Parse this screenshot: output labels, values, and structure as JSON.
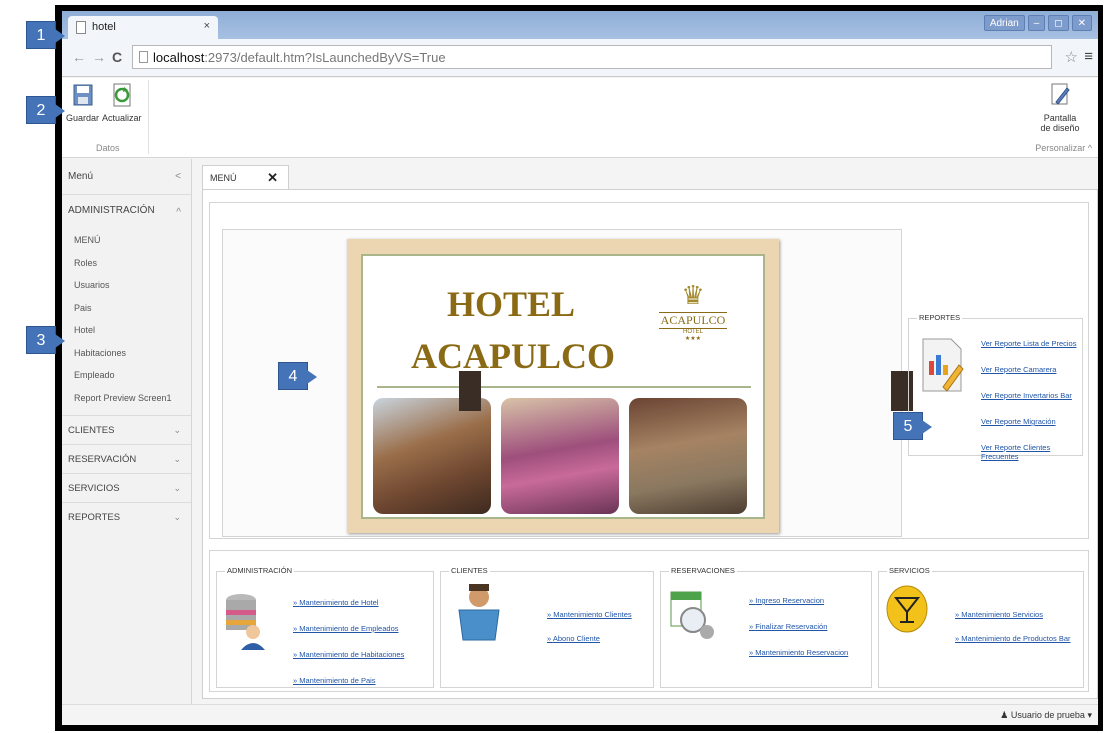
{
  "browser": {
    "tab_title": "hotel",
    "tab_close": "×",
    "window_controls": [
      "Adrian",
      "–",
      "◻",
      "✕"
    ],
    "url_host": "localhost",
    "url_rest": ":2973/default.htm?IsLaunchedByVS=True"
  },
  "ribbon": {
    "save_label": "Guardar",
    "refresh_label": "Actualizar",
    "group_data": "Datos",
    "design_label_1": "Pantalla",
    "design_label_2": "de diseño",
    "group_customize": "Personalizar"
  },
  "sidebar": {
    "title": "Menú",
    "admin_header": "ADMINISTRACIÓN",
    "admin_items": [
      "MENÚ",
      "Roles",
      "Usuarios",
      "Pais",
      "Hotel",
      "Habitaciones",
      "Empleado",
      "Report Preview Screen1"
    ],
    "sections": [
      "CLIENTES",
      "RESERVACIÓN",
      "SERVICIOS",
      "REPORTES"
    ]
  },
  "content": {
    "tab_label": "MENÚ",
    "tab_close": "✕",
    "poster_line1": "HOTEL",
    "poster_line2": "ACAPULCO",
    "logo_name": "ACAPULCO",
    "logo_sub": "HOTEL",
    "logo_stars": "★★★"
  },
  "reportes": {
    "legend": "REPORTES",
    "links": [
      "Ver Reporte Lista de Precios",
      "Ver Reporte Camarera",
      "Ver Reporte Invertarios Bar",
      "Ver Reporte Migración",
      "Ver Reporte Clientes Frecuentes"
    ]
  },
  "sections": {
    "admin": {
      "legend": "ADMINISTRACIÓN",
      "links": [
        "Mantenimiento de Hotel",
        "Mantenimiento de Empleados",
        "Mantenimiento de Habitaciones",
        "Mantenimiento de Pais"
      ]
    },
    "clientes": {
      "legend": "CLIENTES",
      "links": [
        "Mantenimiento Clientes",
        "Abono Cliente"
      ]
    },
    "reservaciones": {
      "legend": "RESERVACIONES",
      "links": [
        "Ingreso Reservacion",
        "Finalizar Reservación",
        "Mantenimiento Reservacion"
      ]
    },
    "servicios": {
      "legend": "SERVICIOS",
      "links": [
        "Mantenimiento Servicios",
        "Mantenimiento de Productos Bar"
      ]
    }
  },
  "status": {
    "user": "Usuario de prueba"
  },
  "callouts": [
    "1",
    "2",
    "3",
    "4",
    "5"
  ],
  "colors": {
    "link": "#2055a8",
    "callout": "#4573b8",
    "poster_gold": "#8a6a14"
  }
}
